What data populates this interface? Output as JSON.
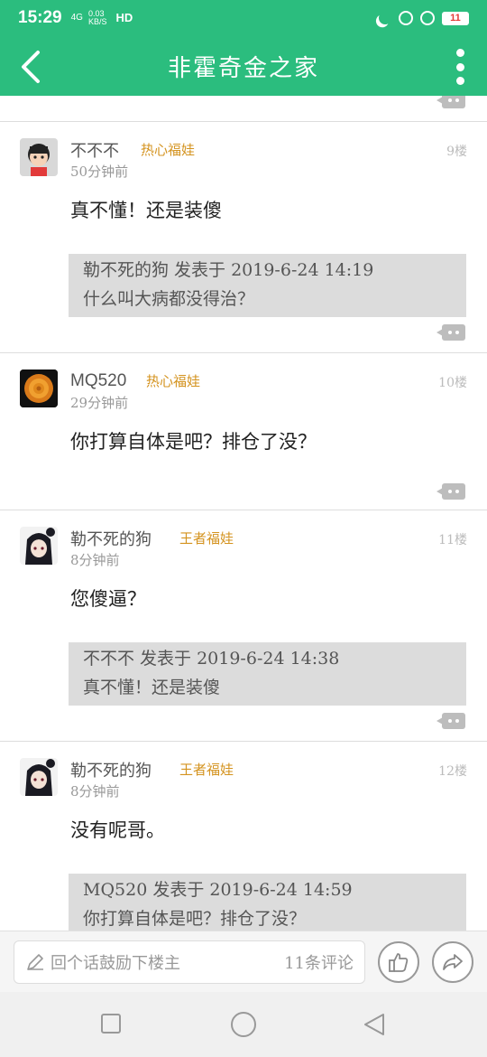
{
  "status_bar": {
    "time": "15:29",
    "network": "4G",
    "speed_value": "0.03",
    "speed_unit": "KB/S",
    "hd": "HD",
    "battery": "11"
  },
  "app_bar": {
    "title": "非霍奇金之家"
  },
  "posts": [
    {
      "username": "不不不",
      "badge": "热心福娃",
      "floor": "9楼",
      "time": "50分钟前",
      "content": "真不懂！还是装傻",
      "quote_head": "勒不死的狗 发表于 2019-6-24 14:19",
      "quote_body": "什么叫大病都没得治？"
    },
    {
      "username": "MQ520",
      "badge": "热心福娃",
      "floor": "10楼",
      "time": "29分钟前",
      "content": "你打算自体是吧？排仓了没？"
    },
    {
      "username": "勒不死的狗",
      "badge": "王者福娃",
      "floor": "11楼",
      "time": "8分钟前",
      "content": "您傻逼？",
      "quote_head": "不不不 发表于 2019-6-24 14:38",
      "quote_body": "真不懂！还是装傻"
    },
    {
      "username": "勒不死的狗",
      "badge": "王者福娃",
      "floor": "12楼",
      "time": "8分钟前",
      "content": "没有呢哥。",
      "quote_head": "MQ520 发表于 2019-6-24 14:59",
      "quote_body": "你打算自体是吧？排仓了没？"
    }
  ],
  "bottom_bar": {
    "placeholder": "回个话鼓励下楼主",
    "comment_count": "11条评论"
  },
  "colors": {
    "brand_green": "#2bbd7e",
    "badge_gold": "#d4931f"
  },
  "icons": [
    "back-arrow-icon",
    "more-vert-icon",
    "comment-icon",
    "pencil-icon",
    "thumb-up-icon",
    "share-icon",
    "square-nav-icon",
    "circle-nav-icon",
    "triangle-nav-icon"
  ]
}
